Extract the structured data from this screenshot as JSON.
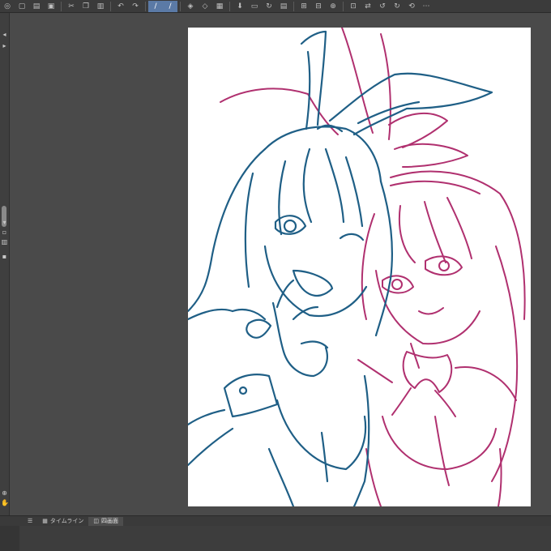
{
  "app": {
    "accent": "#5b7aa6",
    "line_colors": {
      "teal": "#1f5f86",
      "magenta": "#b0306f"
    }
  },
  "toolbar": {
    "buttons": [
      {
        "icon": "app-logo-icon",
        "glyph": "◎"
      },
      {
        "icon": "new-file-icon",
        "glyph": "▢"
      },
      {
        "icon": "open-folder-icon",
        "glyph": "▤"
      },
      {
        "icon": "save-icon",
        "glyph": "▣"
      },
      {
        "icon": "cut-icon",
        "glyph": "✂"
      },
      {
        "icon": "copy-icon",
        "glyph": "❐"
      },
      {
        "icon": "paste-icon",
        "glyph": "▥"
      },
      {
        "icon": "undo-icon",
        "glyph": "↶"
      },
      {
        "icon": "redo-icon",
        "glyph": "↷"
      },
      {
        "icon": "pen-tool-icon",
        "glyph": "/",
        "active": true
      },
      {
        "icon": "brush-tool-icon",
        "glyph": "/",
        "active": true
      },
      {
        "icon": "layers-icon",
        "glyph": "◈"
      },
      {
        "icon": "layer-props-icon",
        "glyph": "◇"
      },
      {
        "icon": "grid-icon",
        "glyph": "▦"
      },
      {
        "icon": "download-icon",
        "glyph": "⬇"
      },
      {
        "icon": "panel-icon",
        "glyph": "▭"
      },
      {
        "icon": "rotate-icon",
        "glyph": "↻"
      },
      {
        "icon": "print-icon",
        "glyph": "▤"
      },
      {
        "icon": "ruler-icon",
        "glyph": "⊞"
      },
      {
        "icon": "snap-icon",
        "glyph": "⊟"
      },
      {
        "icon": "zoom-icon",
        "glyph": "⊕"
      },
      {
        "icon": "fit-icon",
        "glyph": "⊡"
      },
      {
        "icon": "flip-icon",
        "glyph": "⇄"
      },
      {
        "icon": "rotate-left-icon",
        "glyph": "↺"
      },
      {
        "icon": "rotate-right-icon",
        "glyph": "↻"
      },
      {
        "icon": "reset-view-icon",
        "glyph": "⟲"
      },
      {
        "icon": "more-icon",
        "glyph": "⋯"
      }
    ]
  },
  "bottom_tabs": [
    {
      "icon": "timeline-icon",
      "label": "タイムライン"
    },
    {
      "icon": "palette-icon",
      "label": "四画面"
    }
  ]
}
